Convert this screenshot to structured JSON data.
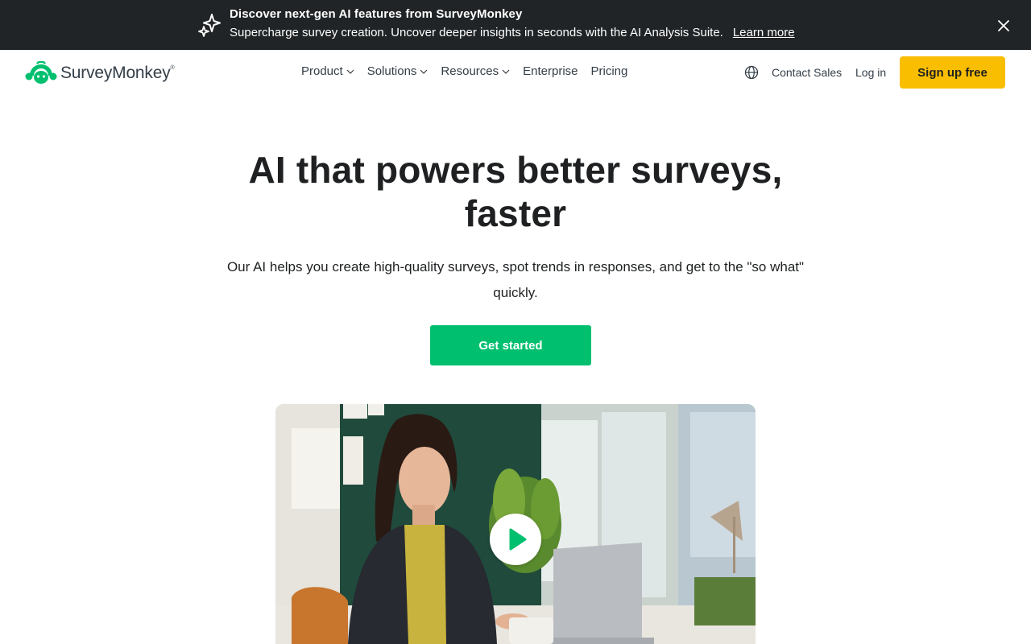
{
  "banner": {
    "title": "Discover next-gen AI features from SurveyMonkey",
    "text": "Supercharge survey creation. Uncover deeper insights in seconds with the AI Analysis Suite.",
    "link_label": "Learn more",
    "icons": {
      "sparkle": "sparkle-icon",
      "close": "close-icon"
    }
  },
  "header": {
    "logo_text": "SurveyMonkey",
    "logo_mark": "®",
    "nav": [
      {
        "label": "Product",
        "has_dropdown": true
      },
      {
        "label": "Solutions",
        "has_dropdown": true
      },
      {
        "label": "Resources",
        "has_dropdown": true
      },
      {
        "label": "Enterprise",
        "has_dropdown": false
      },
      {
        "label": "Pricing",
        "has_dropdown": false
      }
    ],
    "contact_label": "Contact Sales",
    "login_label": "Log in",
    "signup_label": "Sign up free",
    "icons": {
      "language": "globe-icon",
      "dropdown": "chevron-down-icon"
    }
  },
  "hero": {
    "title": "AI that powers better surveys, faster",
    "subtitle": "Our AI helps you create high-quality surveys, spot trends in responses, and get to the \"so what\" quickly.",
    "cta_label": "Get started"
  },
  "video": {
    "play_icon": "play-icon"
  },
  "colors": {
    "banner_bg": "#212426",
    "brand_green": "#00bf6f",
    "signup_yellow": "#f9be00",
    "text_dark": "#1e2022",
    "nav_text": "#333e48"
  }
}
